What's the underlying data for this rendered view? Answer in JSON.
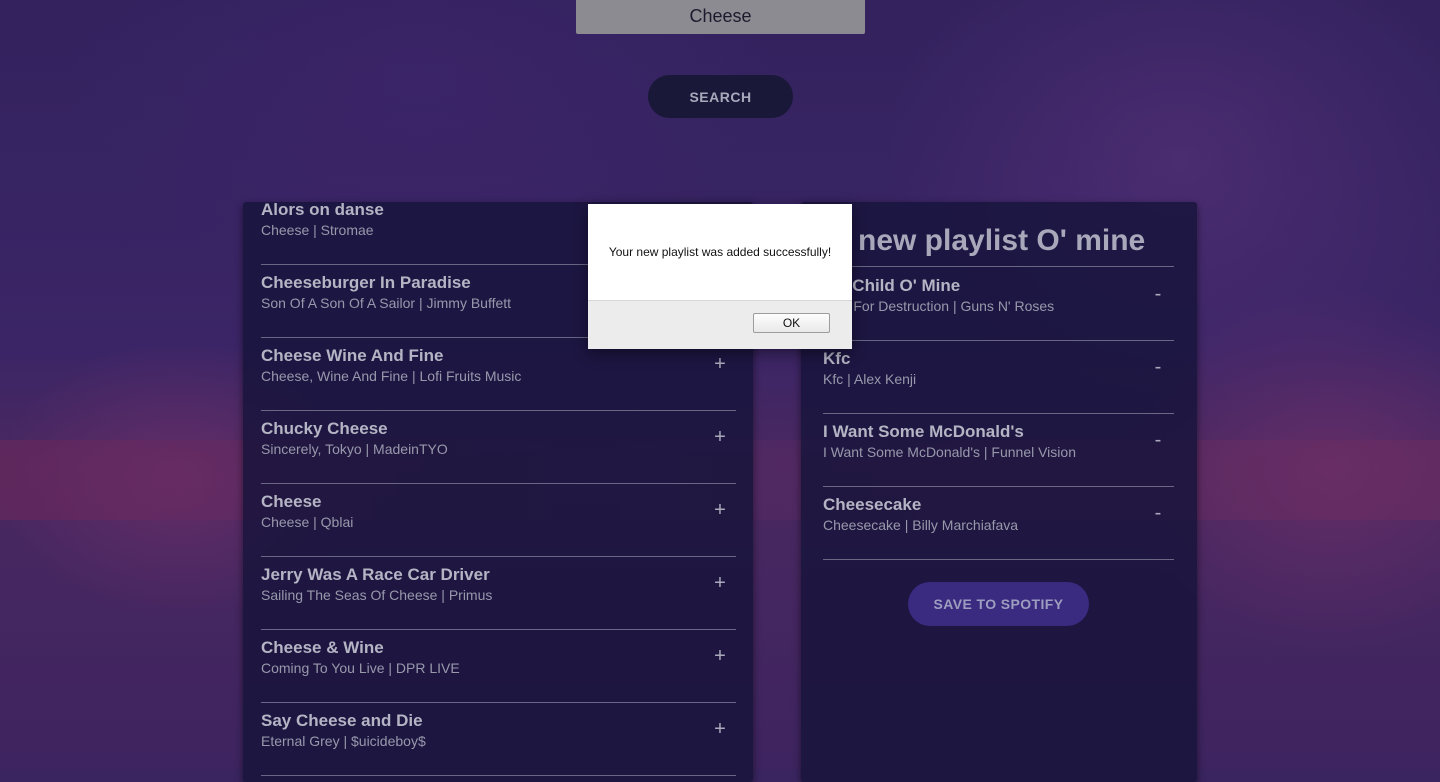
{
  "search": {
    "value": "Cheese",
    "button_label": "SEARCH"
  },
  "results": {
    "add_symbol": "+",
    "tracks": [
      {
        "name": "Alors on danse",
        "info": "Cheese | Stromae"
      },
      {
        "name": "Cheeseburger In Paradise",
        "info": "Son Of A Son Of A Sailor | Jimmy Buffett"
      },
      {
        "name": "Cheese Wine And Fine",
        "info": "Cheese, Wine And Fine | Lofi Fruits Music"
      },
      {
        "name": "Chucky Cheese",
        "info": "Sincerely, Tokyo | MadeinTYO"
      },
      {
        "name": "Cheese",
        "info": "Cheese | Qblai"
      },
      {
        "name": "Jerry Was A Race Car Driver",
        "info": "Sailing The Seas Of Cheese | Primus"
      },
      {
        "name": "Cheese & Wine",
        "info": "Coming To You Live | DPR LIVE"
      },
      {
        "name": "Say Cheese and Die",
        "info": "Eternal Grey | $uicideboy$"
      }
    ]
  },
  "playlist": {
    "title": "new playlist O' mine",
    "remove_symbol": "-",
    "tracks": [
      {
        "name": "eet Child O' Mine",
        "info": "etite For Destruction | Guns N' Roses"
      },
      {
        "name": "Kfc",
        "info": "Kfc | Alex Kenji"
      },
      {
        "name": "I Want Some McDonald's",
        "info": "I Want Some McDonald's | Funnel Vision"
      },
      {
        "name": "Cheesecake",
        "info": "Cheesecake | Billy Marchiafava"
      }
    ],
    "save_label": "SAVE TO SPOTIFY"
  },
  "alert": {
    "message": "Your new playlist was added successfully!",
    "ok_label": "OK"
  }
}
